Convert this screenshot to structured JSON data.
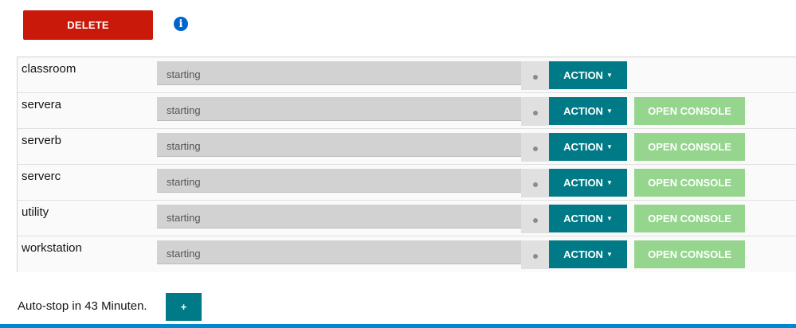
{
  "toolbar": {
    "delete_label": "DELETE",
    "info_icon": "info-circle-icon"
  },
  "vms": [
    {
      "name": "classroom",
      "status": "starting",
      "action_label": "ACTION",
      "console_label": ""
    },
    {
      "name": "servera",
      "status": "starting",
      "action_label": "ACTION",
      "console_label": "OPEN CONSOLE"
    },
    {
      "name": "serverb",
      "status": "starting",
      "action_label": "ACTION",
      "console_label": "OPEN CONSOLE"
    },
    {
      "name": "serverc",
      "status": "starting",
      "action_label": "ACTION",
      "console_label": "OPEN CONSOLE"
    },
    {
      "name": "utility",
      "status": "starting",
      "action_label": "ACTION",
      "console_label": "OPEN CONSOLE"
    },
    {
      "name": "workstation",
      "status": "starting",
      "action_label": "ACTION",
      "console_label": "OPEN CONSOLE"
    }
  ],
  "autostop": {
    "text": "Auto-stop in 43 Minuten.",
    "add_label": "+"
  },
  "colors": {
    "danger": "#c9190b",
    "primary": "#007a87",
    "console_disabled": "#95d58e",
    "info": "#0066cc",
    "status_bg": "#d2d2d2"
  }
}
